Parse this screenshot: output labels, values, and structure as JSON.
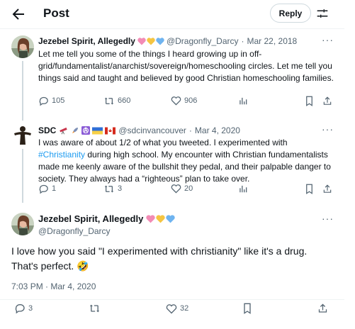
{
  "header": {
    "title": "Post",
    "reply_label": "Reply"
  },
  "tweets": [
    {
      "name": "Jezebel Spirit, Allegedly",
      "hearts": [
        "#f28bb5",
        "#f5c542",
        "#6fb4f0"
      ],
      "handle": "@Dragonfly_Darcy",
      "sep": "·",
      "date": "Mar 22, 2018",
      "text": "Let me tell you some of the things I heard growing up in off-grid/fundamentalist/anarchist/sovereign/homeschooling circles. Let me tell you things said and taught and believed by good Christian homeschooling families.",
      "replies": "105",
      "reposts": "660",
      "likes": "906"
    },
    {
      "name": "SDC",
      "handle": "@sdcinvancouver",
      "sep": "·",
      "date": "Mar 4, 2020",
      "text_before": "I was aware of about 1/2 of what you tweeted. I experimented with",
      "hashtag": "#Christianity",
      "text_after": "during high school. My encounter with Christian fundamentalists made me keenly aware of the bullshit they pedal, and their palpable danger to society. They always had a “righteous” plan to take over.",
      "replies": "1",
      "reposts": "3",
      "likes": "20"
    }
  ],
  "main_tweet": {
    "name": "Jezebel Spirit, Allegedly",
    "hearts": [
      "#f28bb5",
      "#f5c542",
      "#6fb4f0"
    ],
    "handle": "@Dragonfly_Darcy",
    "text": "I love how you said \"I experimented with christianity\" like it's a drug. That's perfect. 🤣",
    "timestamp": "7:03 PM · Mar 4, 2020",
    "replies": "3",
    "likes": "32"
  },
  "colors": {
    "accent": "#1d9bf0",
    "muted": "#536471",
    "border": "#eff3f4"
  }
}
